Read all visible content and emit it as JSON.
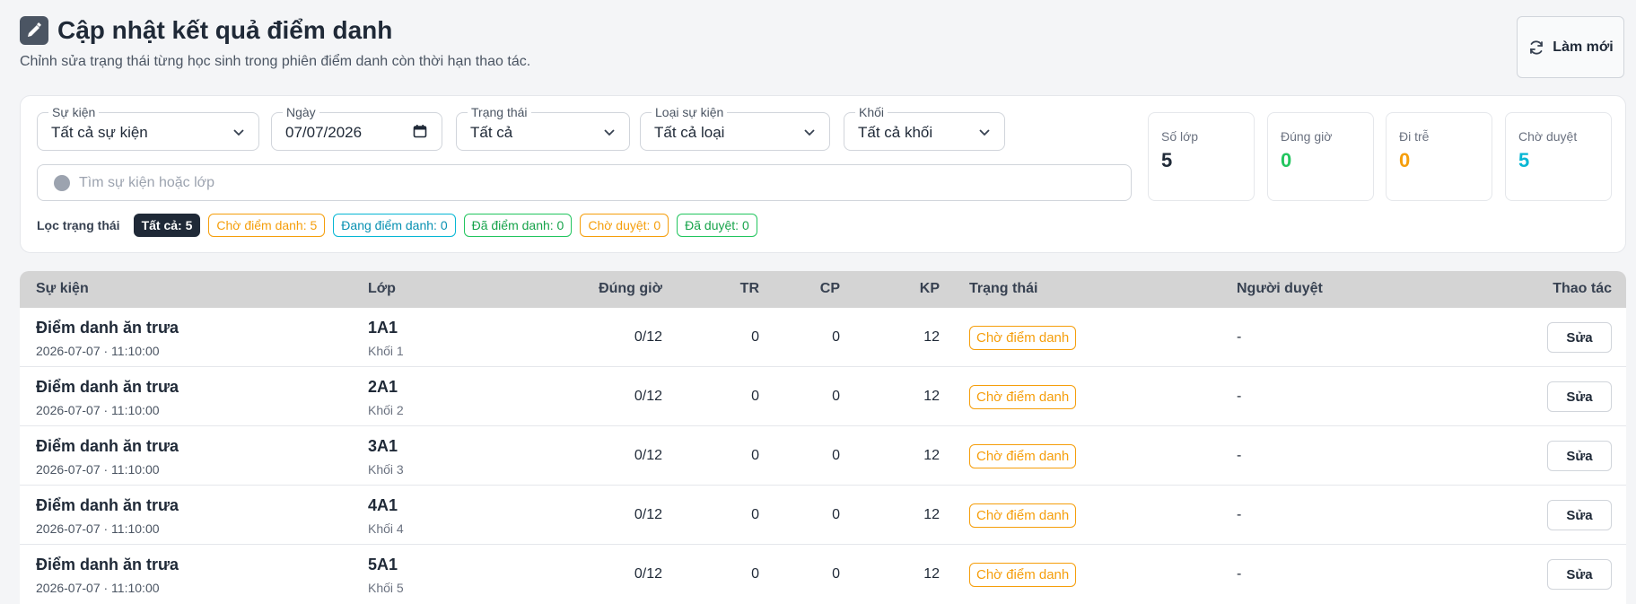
{
  "header": {
    "title": "Cập nhật kết quả điểm danh",
    "subtitle": "Chỉnh sửa trạng thái từng học sinh trong phiên điểm danh còn thời hạn thao tác.",
    "refresh_label": "Làm mới"
  },
  "filters": {
    "event": {
      "label": "Sự kiện",
      "value": "Tất cả sự kiện"
    },
    "date": {
      "label": "Ngày",
      "value": "07/07/2026"
    },
    "status": {
      "label": "Trạng thái",
      "value": "Tất cả"
    },
    "event_type": {
      "label": "Loại sự kiện",
      "value": "Tất cả loại"
    },
    "grade": {
      "label": "Khối",
      "value": "Tất cả khối"
    },
    "search_placeholder": "Tìm sự kiện hoặc lớp"
  },
  "status_filter": {
    "label": "Lọc trạng thái",
    "chips": [
      {
        "text": "Tất cả: 5",
        "style": "active"
      },
      {
        "text": "Chờ điểm danh: 5",
        "style": "orange"
      },
      {
        "text": "Đang điểm danh: 0",
        "style": "cyan"
      },
      {
        "text": "Đã điểm danh: 0",
        "style": "green"
      },
      {
        "text": "Chờ duyệt: 0",
        "style": "orange"
      },
      {
        "text": "Đã duyệt: 0",
        "style": "green"
      }
    ]
  },
  "stats": [
    {
      "label": "Số lớp",
      "value": "5",
      "color": "#1f2937"
    },
    {
      "label": "Đúng giờ",
      "value": "0",
      "color": "#22c55e"
    },
    {
      "label": "Đi trễ",
      "value": "0",
      "color": "#f59e0b"
    },
    {
      "label": "Chờ duyệt",
      "value": "5",
      "color": "#06b6d4"
    }
  ],
  "table": {
    "headers": {
      "event": "Sự kiện",
      "class": "Lớp",
      "on_time": "Đúng giờ",
      "tr": "TR",
      "cp": "CP",
      "kp": "KP",
      "status": "Trạng thái",
      "approver": "Người duyệt",
      "actions": "Thao tác"
    },
    "rows": [
      {
        "event": "Điểm danh ăn trưa",
        "time": "2026-07-07 · 11:10:00",
        "class": "1A1",
        "grade": "Khối 1",
        "on_time": "0/12",
        "tr": "0",
        "cp": "0",
        "kp": "12",
        "status": "Chờ điểm danh",
        "approver": "-",
        "action": "Sửa"
      },
      {
        "event": "Điểm danh ăn trưa",
        "time": "2026-07-07 · 11:10:00",
        "class": "2A1",
        "grade": "Khối 2",
        "on_time": "0/12",
        "tr": "0",
        "cp": "0",
        "kp": "12",
        "status": "Chờ điểm danh",
        "approver": "-",
        "action": "Sửa"
      },
      {
        "event": "Điểm danh ăn trưa",
        "time": "2026-07-07 · 11:10:00",
        "class": "3A1",
        "grade": "Khối 3",
        "on_time": "0/12",
        "tr": "0",
        "cp": "0",
        "kp": "12",
        "status": "Chờ điểm danh",
        "approver": "-",
        "action": "Sửa"
      },
      {
        "event": "Điểm danh ăn trưa",
        "time": "2026-07-07 · 11:10:00",
        "class": "4A1",
        "grade": "Khối 4",
        "on_time": "0/12",
        "tr": "0",
        "cp": "0",
        "kp": "12",
        "status": "Chờ điểm danh",
        "approver": "-",
        "action": "Sửa"
      },
      {
        "event": "Điểm danh ăn trưa",
        "time": "2026-07-07 · 11:10:00",
        "class": "5A1",
        "grade": "Khối 5",
        "on_time": "0/12",
        "tr": "0",
        "cp": "0",
        "kp": "12",
        "status": "Chờ điểm danh",
        "approver": "-",
        "action": "Sửa"
      }
    ]
  }
}
